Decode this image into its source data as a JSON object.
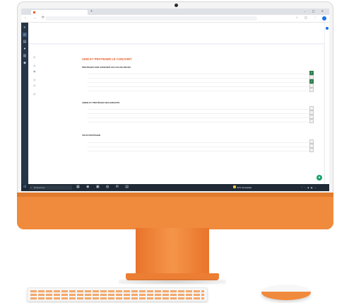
{
  "browser": {
    "tab_title": "",
    "new_tab_label": "+",
    "window_controls": "– ▢ ✕",
    "url": ""
  },
  "app": {
    "logo": "",
    "logo_sub": "",
    "simulation_title": "",
    "header_right": "",
    "user_line1": "",
    "user_line2": "",
    "breadcrumb": "",
    "tabs": [
      {
        "label": ""
      },
      {
        "label": ""
      },
      {
        "label": ""
      },
      {
        "label": ""
      }
    ],
    "tab_right_action": ""
  },
  "content": {
    "section_label": "",
    "intro": "",
    "subnav": [
      {
        "label": ""
      },
      {
        "label": ""
      },
      {
        "label": ""
      },
      {
        "label": ""
      },
      {
        "label": ""
      },
      {
        "label": ""
      }
    ],
    "page_title": "AIDE ET PROTEGER LE CONJOINT",
    "groups": [
      {
        "title": "PROTÉGER SON CONJOINT EN CAS DE DÉCÈS",
        "rows": [
          {
            "label": "",
            "checked": true
          },
          {
            "label": "",
            "checked": false
          },
          {
            "label": "",
            "checked": true
          },
          {
            "label": "",
            "checked": false
          },
          {
            "label": "",
            "checked": false
          }
        ],
        "more": ""
      },
      {
        "title": "AIDER ET PROTÉGER SES ENFANTS",
        "rows": [
          {
            "label": "",
            "checked": false
          },
          {
            "label": "",
            "checked": false
          },
          {
            "label": "",
            "checked": false
          },
          {
            "label": "",
            "checked": false
          }
        ],
        "more": ""
      },
      {
        "title": "VOUS PROTÉGER",
        "rows": [
          {
            "label": "",
            "checked": false
          },
          {
            "label": "",
            "checked": false
          },
          {
            "label": "",
            "checked": false
          }
        ],
        "more": ""
      }
    ]
  },
  "taskbar": {
    "search_placeholder": "Rechercher",
    "weather": "20°C Ensoleillé",
    "clock_time": "",
    "clock_date": ""
  },
  "colors": {
    "brand": "#e6602a",
    "checked": "#2e7d4f",
    "shell": "#f08a3c"
  },
  "icons": [
    "search-icon",
    "windows-icon",
    "check-icon",
    "home-icon",
    "folder-icon",
    "chat-icon",
    "user-icon"
  ]
}
